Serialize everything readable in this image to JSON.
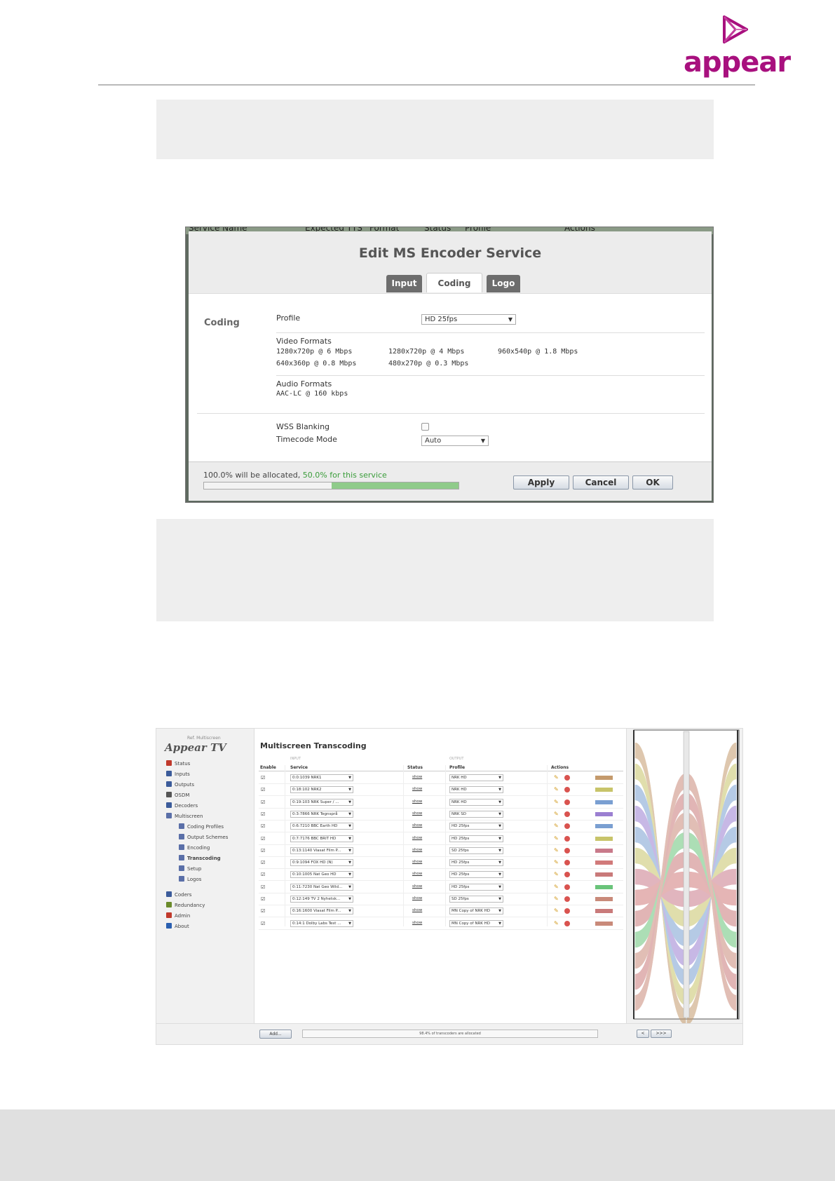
{
  "brand": {
    "logo_text": "appear",
    "color": "#a8107e"
  },
  "dialog": {
    "title": "Edit MS Encoder Service",
    "tabs": [
      {
        "label": "Input",
        "active": false
      },
      {
        "label": "Coding",
        "active": true
      },
      {
        "label": "Logo",
        "active": false
      }
    ],
    "section": "Coding",
    "profile_label": "Profile",
    "profile_value": "HD 25fps",
    "video_formats_label": "Video Formats",
    "video_formats": [
      "1280x720p @ 6 Mbps",
      "1280x720p @ 4 Mbps",
      "960x540p @ 1.8 Mbps",
      "640x360p @ 0.8 Mbps",
      "480x270p @ 0.3 Mbps"
    ],
    "audio_formats_label": "Audio Formats",
    "audio_formats": [
      "AAC-LC @ 160 kbps"
    ],
    "wss_label": "WSS Blanking",
    "wss_checked": false,
    "timecode_label": "Timecode Mode",
    "timecode_value": "Auto",
    "alloc_text": "100.0% will be allocated,",
    "alloc_service_text": "50.0% for this service",
    "alloc_total": 1.0,
    "alloc_service": 0.5,
    "buttons": {
      "apply": "Apply",
      "cancel": "Cancel",
      "ok": "OK"
    },
    "bg_columns": [
      "Service Name",
      "Expected TTS",
      "Format",
      "Status",
      "Profile",
      "Actions"
    ]
  },
  "ms": {
    "brand_small": "Ref. Multiscreen",
    "brand": "Appear TV",
    "nav": [
      {
        "label": "Status",
        "icon": "status-icon",
        "color": "#c0392b",
        "indent": 0,
        "bold": false
      },
      {
        "label": "Inputs",
        "icon": "inputs-icon",
        "color": "#3b5b9a",
        "indent": 0,
        "bold": false
      },
      {
        "label": "Outputs",
        "icon": "outputs-icon",
        "color": "#3b5b9a",
        "indent": 0,
        "bold": false
      },
      {
        "label": "OSDM",
        "icon": "osdm-icon",
        "color": "#555555",
        "indent": 0,
        "bold": false
      },
      {
        "label": "Decoders",
        "icon": "decoders-icon",
        "color": "#3b5b9a",
        "indent": 0,
        "bold": false
      },
      {
        "label": "Multiscreen",
        "icon": "multiscreen-icon",
        "color": "#5a6fa8",
        "indent": 0,
        "bold": false
      },
      {
        "label": "Coding Profiles",
        "icon": "coding-profiles-icon",
        "color": "#5a6fa8",
        "indent": 1,
        "bold": false
      },
      {
        "label": "Output Schemes",
        "icon": "output-schemes-icon",
        "color": "#5a6fa8",
        "indent": 1,
        "bold": false
      },
      {
        "label": "Encoding",
        "icon": "encoding-icon",
        "color": "#5a6fa8",
        "indent": 1,
        "bold": false
      },
      {
        "label": "Transcoding",
        "icon": "transcoding-icon",
        "color": "#5a6fa8",
        "indent": 1,
        "bold": true
      },
      {
        "label": "Setup",
        "icon": "setup-icon",
        "color": "#5a6fa8",
        "indent": 1,
        "bold": false
      },
      {
        "label": "Logos",
        "icon": "logos-icon",
        "color": "#5a6fa8",
        "indent": 1,
        "bold": false
      },
      {
        "label": "Coders",
        "icon": "coders-icon",
        "color": "#3b5b9a",
        "indent": 0,
        "bold": false
      },
      {
        "label": "Redundancy",
        "icon": "redundancy-icon",
        "color": "#6a8a2a",
        "indent": 0,
        "bold": false
      },
      {
        "label": "Admin",
        "icon": "admin-icon",
        "color": "#c0392b",
        "indent": 0,
        "bold": false
      },
      {
        "label": "About",
        "icon": "about-icon",
        "color": "#2a5fb0",
        "indent": 0,
        "bold": false
      }
    ],
    "title": "Multiscreen Transcoding",
    "group_input": "INPUT",
    "group_output": "OUTPUT",
    "headers": {
      "enable": "Enable",
      "service": "Service",
      "status": "Status",
      "profile": "Profile",
      "actions": "Actions"
    },
    "rows": [
      {
        "service": "0:0:1039 NRK1",
        "status": "show",
        "profile": "NRK HD",
        "color": "#c49a6c"
      },
      {
        "service": "0:18:102 NRK2",
        "status": "show",
        "profile": "NRK HD",
        "color": "#c8c46a"
      },
      {
        "service": "0:19:103 NRK Super / ...",
        "status": "show",
        "profile": "NRK HD",
        "color": "#7a9fd1"
      },
      {
        "service": "0:3:7866 NRK Tegnsprå",
        "status": "show",
        "profile": "NRK SD",
        "color": "#9b7fd1"
      },
      {
        "service": "0:6:7210 BBC Earth HD",
        "status": "show",
        "profile": "HD 25fps",
        "color": "#7a9fd1"
      },
      {
        "service": "0:7:7176 BBC BRIT HD",
        "status": "show",
        "profile": "HD 25fps",
        "color": "#c8c46a"
      },
      {
        "service": "0:13:1140 Viasat Film P...",
        "status": "show",
        "profile": "SD 25fps",
        "color": "#c97a8a"
      },
      {
        "service": "0:9:1094 FOX HD (N)",
        "status": "show",
        "profile": "HD 25fps",
        "color": "#d17a7a"
      },
      {
        "service": "0:10:1005 Nat Geo HD",
        "status": "show",
        "profile": "HD 25fps",
        "color": "#c97a7a"
      },
      {
        "service": "0:11:7230 Nat Geo Wild...",
        "status": "show",
        "profile": "HD 25fps",
        "color": "#6ac47a"
      },
      {
        "service": "0:12:149 TV 2 Nyhetsk...",
        "status": "show",
        "profile": "SD 25fps",
        "color": "#c98a7a"
      },
      {
        "service": "0:16:1600 Viasat Film P...",
        "status": "show",
        "profile": "MN Copy of NRK HD",
        "color": "#c97a7a"
      },
      {
        "service": "0:14:1 Dolby Labs Test ...",
        "status": "show",
        "profile": "MN Copy of NRK HD",
        "color": "#c98a7a"
      }
    ],
    "add_label": "Add...",
    "alloc_text": "98.4% of transcoders are allocated",
    "nav_prev": "<",
    "nav_next": ">>>"
  }
}
